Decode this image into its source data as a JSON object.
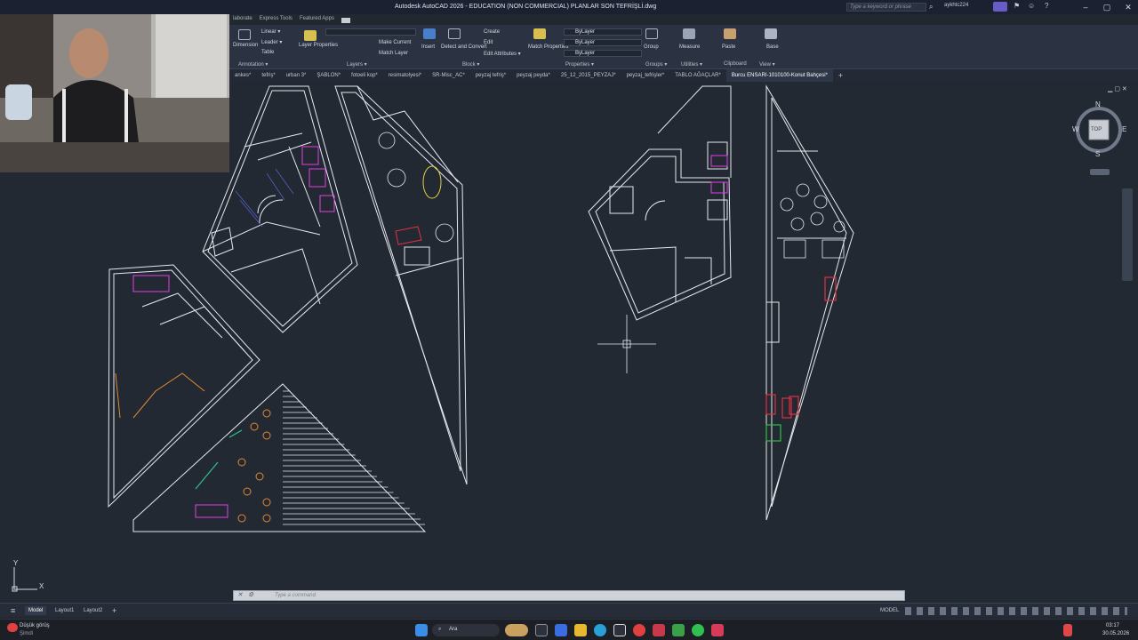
{
  "titlebar": {
    "title": "Autodesk AutoCAD 2026 - EDUCATION (NON COMMERCIAL)   PLANLAR SON TEFRİŞLİ.dwg",
    "search_placeholder": "Type a keyword or phrase",
    "user": "aykhtc224",
    "qat_tabs": [
      "laborate",
      "Express Tools",
      "Featured Apps"
    ]
  },
  "ribbon": {
    "annotation": {
      "label": "Annotation ▾",
      "items": [
        "Dimension",
        "Linear ▾",
        "Leader ▾",
        "Table"
      ]
    },
    "layers": {
      "label": "Layers ▾",
      "items": [
        "Layer Properties",
        "Make Current",
        "Match Layer"
      ]
    },
    "block": {
      "label": "Block ▾",
      "items": [
        "Insert",
        "Detect and Convert",
        "Create",
        "Edit",
        "Edit Attributes ▾"
      ]
    },
    "properties": {
      "label": "Properties ▾",
      "items": [
        "Match Properties"
      ],
      "boxes": [
        "ByLayer",
        "ByLayer",
        "ByLayer"
      ]
    },
    "groups": {
      "label": "Groups ▾",
      "items": [
        "Group"
      ]
    },
    "utilities": {
      "label": "Utilities ▾",
      "items": [
        "Measure"
      ]
    },
    "clipboard": {
      "label": "Clipboard",
      "items": [
        "Paste"
      ]
    },
    "view": {
      "label": "View ▾",
      "items": [
        "Base"
      ]
    }
  },
  "file_tabs": [
    "ankes*",
    "tefriş*",
    "urban 3*",
    "ŞABLON*",
    "fotoeli kop*",
    "resimatolyesi*",
    "SR-Misc_AC*",
    "peyzaj tefriş*",
    "peyzaj peyda*",
    "25_12_2015_PEYZAJ*",
    "peyzaj_tefrişler*",
    "TABLO AĞAÇLAR*",
    "Burcu ENSARI-1010100-Konut Bahçesi*"
  ],
  "active_file_tab": 12,
  "viewcube": {
    "north": "N",
    "south": "S",
    "east": "E",
    "west": "W",
    "face": "TOP"
  },
  "command": {
    "placeholder": "Type a command"
  },
  "statusbar": {
    "layouts": [
      "Model",
      "Layout1",
      "Layout2"
    ],
    "active_layout": "Model",
    "mode": "MODEL",
    "plus": "+"
  },
  "taskbar": {
    "weather_line1": "Düşük görüş",
    "weather_line2": "Şimdi",
    "search": "Ara",
    "time": "03:17",
    "date": "30.05.2026"
  },
  "ucs": {
    "x": "X",
    "y": "Y"
  },
  "colors": {
    "canvas": "#222933",
    "linework": "#e6e9ee",
    "magenta": "#e040e0",
    "blue": "#5060c0",
    "orange": "#e08a30",
    "red": "#e03040",
    "green": "#30c040",
    "teal": "#30c090"
  }
}
